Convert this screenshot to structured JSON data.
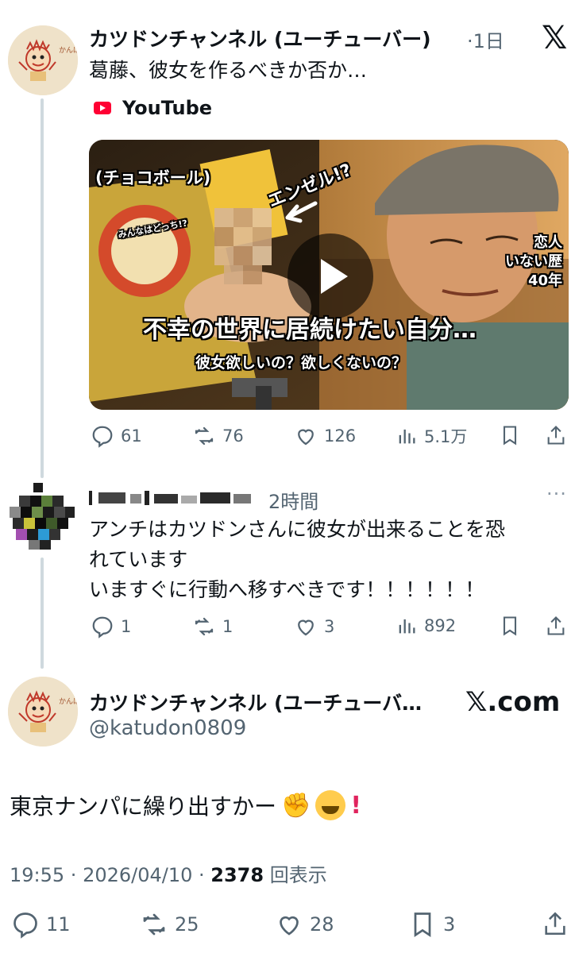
{
  "tweet1": {
    "author_name": "カツドンチャンネル (ユーチューバー)",
    "separator": "·",
    "time": "1日",
    "text": "葛藤、彼女を作るべきか否か…",
    "link_source": "YouTube",
    "video": {
      "caption_choco": "(チョコボール)",
      "caption_angel": "エンゼル!?",
      "caption_choco_box": "みんなはどっち!?",
      "caption_side": [
        "恋人",
        "いない歴",
        "40年"
      ],
      "caption_main": "不幸の世界に居続けたい自分…",
      "caption_sub": "彼女欲しいの？欲しくないの？"
    },
    "stats": {
      "replies": "61",
      "reposts": "76",
      "likes": "126",
      "views": "5.1万"
    }
  },
  "reply": {
    "time": "2時間",
    "text_lines": [
      "アンチはカツドンさんに彼女が出来ることを恐",
      "れています",
      "いますぐに行動へ移すべきです！！！！！！"
    ],
    "stats": {
      "replies": "1",
      "reposts": "1",
      "likes": "3",
      "views": "892"
    }
  },
  "main_tweet": {
    "author_name": "カツドンチャンネル (ユーチューバ…",
    "handle": "@katudon0809",
    "site": "𝕏.com",
    "text": "東京ナンパに繰り出すかー",
    "time": "19:55",
    "date": "2026/04/10",
    "views_count": "2378",
    "views_label": "回表示",
    "stats": {
      "replies": "11",
      "reposts": "25",
      "likes": "28",
      "bookmarks": "3"
    }
  },
  "icons": [
    "x-logo-icon",
    "youtube-icon",
    "reply-icon",
    "repost-icon",
    "like-icon",
    "views-icon",
    "bookmark-icon",
    "share-icon",
    "more-icon",
    "play-icon"
  ],
  "colors": {
    "text": "#0f1419",
    "muted": "#536471",
    "thread_line": "#cfd9de",
    "youtube_red": "#ff0033"
  }
}
